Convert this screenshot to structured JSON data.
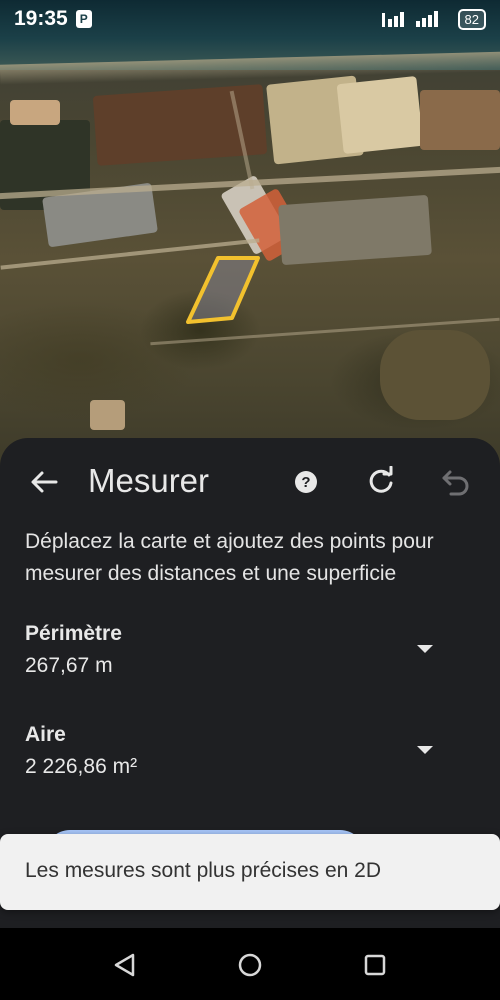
{
  "status_bar": {
    "time": "19:35",
    "app_icon": "P",
    "battery": "82",
    "icons": [
      "parking-notification-icon",
      "signal-icon",
      "battery-icon"
    ]
  },
  "map": {
    "description_icon": "satellite-map",
    "polygon_color": "#f2c12e"
  },
  "sheet": {
    "title": "Mesurer",
    "instructions": "Déplacez la carte et ajoutez des points pour mesurer des distances et une superficie",
    "perimeter": {
      "label": "Périmètre",
      "value": "267,67 m"
    },
    "area": {
      "label": "Aire",
      "value": "2 226,86 m²"
    },
    "icons": [
      "back-arrow-icon",
      "help-icon",
      "refresh-icon",
      "undo-icon",
      "chevron-down-icon"
    ],
    "accent": "#a8c7fa",
    "background": "#1e1f22"
  },
  "toast": {
    "text": "Les mesures sont plus précises en 2D"
  },
  "nav_bar": {
    "icons": [
      "back-triangle-icon",
      "home-circle-icon",
      "recents-square-icon"
    ]
  }
}
